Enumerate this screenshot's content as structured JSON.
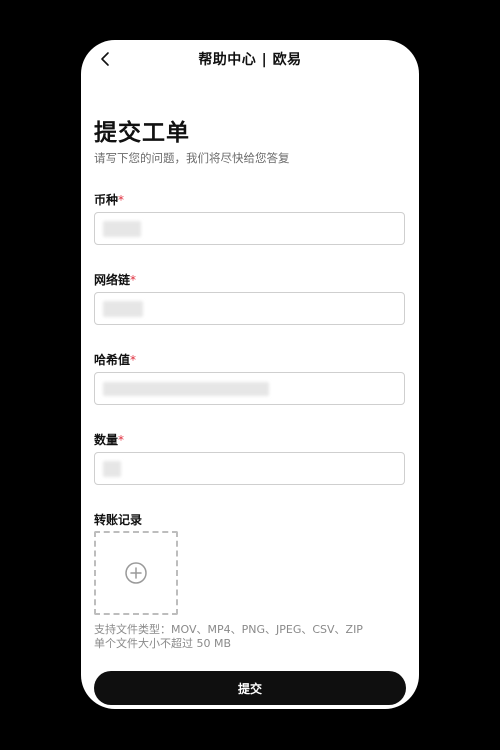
{
  "header": {
    "title": "帮助中心 | 欧易"
  },
  "page": {
    "title": "提交工单",
    "subtitle": "请写下您的问题，我们将尽快给您答复"
  },
  "fields": [
    {
      "label": "币种",
      "required_mark": "*",
      "value": ""
    },
    {
      "label": "网络链",
      "required_mark": "*",
      "value": ""
    },
    {
      "label": "哈希值",
      "required_mark": "*",
      "value": ""
    },
    {
      "label": "数量",
      "required_mark": "*",
      "value": ""
    }
  ],
  "upload": {
    "label": "转账记录",
    "hint_types": "支持文件类型：MOV、MP4、PNG、JPEG、CSV、ZIP",
    "hint_size": "单个文件大小不超过 50 MB"
  },
  "submit": {
    "label": "提交"
  },
  "icons": {
    "back": "chevron-left-icon",
    "add": "plus-circle-icon"
  },
  "colors": {
    "background": "#000000",
    "surface": "#ffffff",
    "required": "#e0303f",
    "button": "#0f0f0f"
  }
}
